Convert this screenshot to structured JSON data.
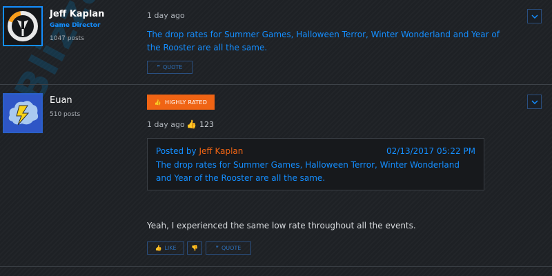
{
  "posts": [
    {
      "author": "Jeff Kaplan",
      "role": "Game Director",
      "post_count": "1047 posts",
      "time": "1 day ago",
      "body": "The drop rates for Summer Games, Halloween Terror, Winter Wonderland and Year of the Rooster are all the same.",
      "quote_label": "QUOTE",
      "avatar_icon": "overwatch-logo-icon",
      "accent_color": "#148eff"
    },
    {
      "author": "Euan",
      "post_count": "510 posts",
      "badge": "HIGHLY RATED",
      "time": "1 day ago",
      "likes": "123",
      "quote": {
        "posted_by_prefix": "Posted by ",
        "posted_by": "Jeff Kaplan",
        "date": "02/13/2017 05:22 PM",
        "body": "The drop rates for Summer Games, Halloween Terror, Winter Wonderland and Year of the Rooster are all the same."
      },
      "reply": "Yeah, I experienced the same low rate throughout all the events.",
      "like_label": "LIKE",
      "quote_label": "QUOTE",
      "avatar_icon": "lightning-cloud-icon",
      "badge_color": "#f06414"
    }
  ],
  "watermark": "Blizzard"
}
